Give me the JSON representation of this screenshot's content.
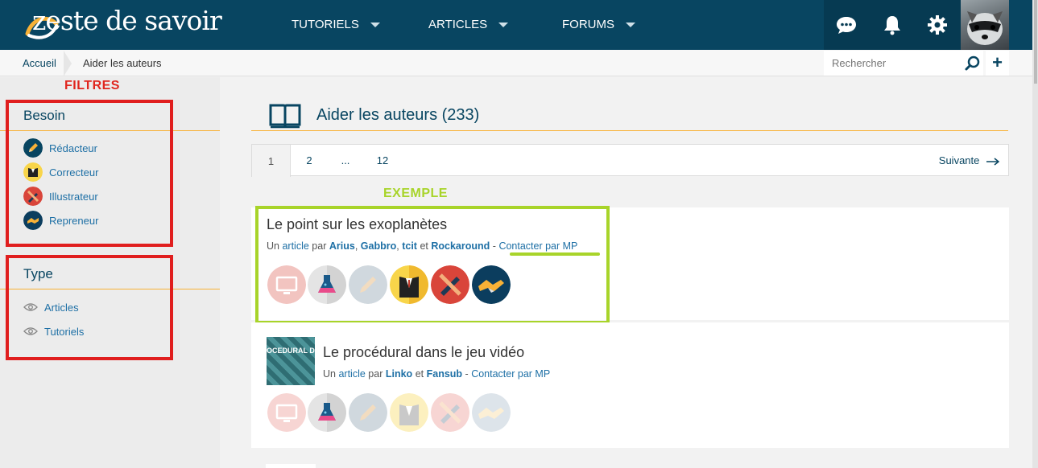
{
  "header": {
    "logo_text": "zeste de savoir",
    "nav": [
      {
        "label": "TUTORIELS"
      },
      {
        "label": "ARTICLES"
      },
      {
        "label": "FORUMS"
      }
    ]
  },
  "breadcrumb": {
    "home": "Accueil",
    "current": "Aider les auteurs"
  },
  "search": {
    "placeholder": "Rechercher",
    "plus": "+"
  },
  "annotations": {
    "filters": "FILTRES",
    "example": "EXEMPLE"
  },
  "sidebar": {
    "besoin": {
      "heading": "Besoin",
      "items": [
        {
          "label": "Rédacteur"
        },
        {
          "label": "Correcteur"
        },
        {
          "label": "Illustrateur"
        },
        {
          "label": "Repreneur"
        }
      ]
    },
    "type": {
      "heading": "Type",
      "items": [
        {
          "label": "Articles"
        },
        {
          "label": "Tutoriels"
        }
      ]
    }
  },
  "main": {
    "title": "Aider les auteurs (233)",
    "pagination": {
      "pages": [
        "1",
        "2",
        "...",
        "12"
      ],
      "next": "Suivante"
    },
    "cards": [
      {
        "title": "Le point sur les exoplanètes",
        "prefix": "Un",
        "type": "article",
        "by": "par",
        "authors": [
          "Arius",
          "Gabbro",
          "tcit",
          "Rockaround"
        ],
        "sep1": ",",
        "sep2": ",",
        "and": "et",
        "dash": "-",
        "contact": "Contacter par MP"
      },
      {
        "title": "Le procédural dans le jeu vidéo",
        "thumb_text": "OCEDURAL DANS",
        "prefix": "Un",
        "type": "article",
        "by": "par",
        "authors": [
          "Linko",
          "Fansub"
        ],
        "and": "et",
        "dash": "-",
        "contact": "Contacter par MP"
      }
    ]
  },
  "colors": {
    "header": "#084561",
    "accent": "#f8b136",
    "annotation_red": "#e01e1e",
    "annotation_green": "#a8d42a",
    "link": "#1d6fa5"
  }
}
